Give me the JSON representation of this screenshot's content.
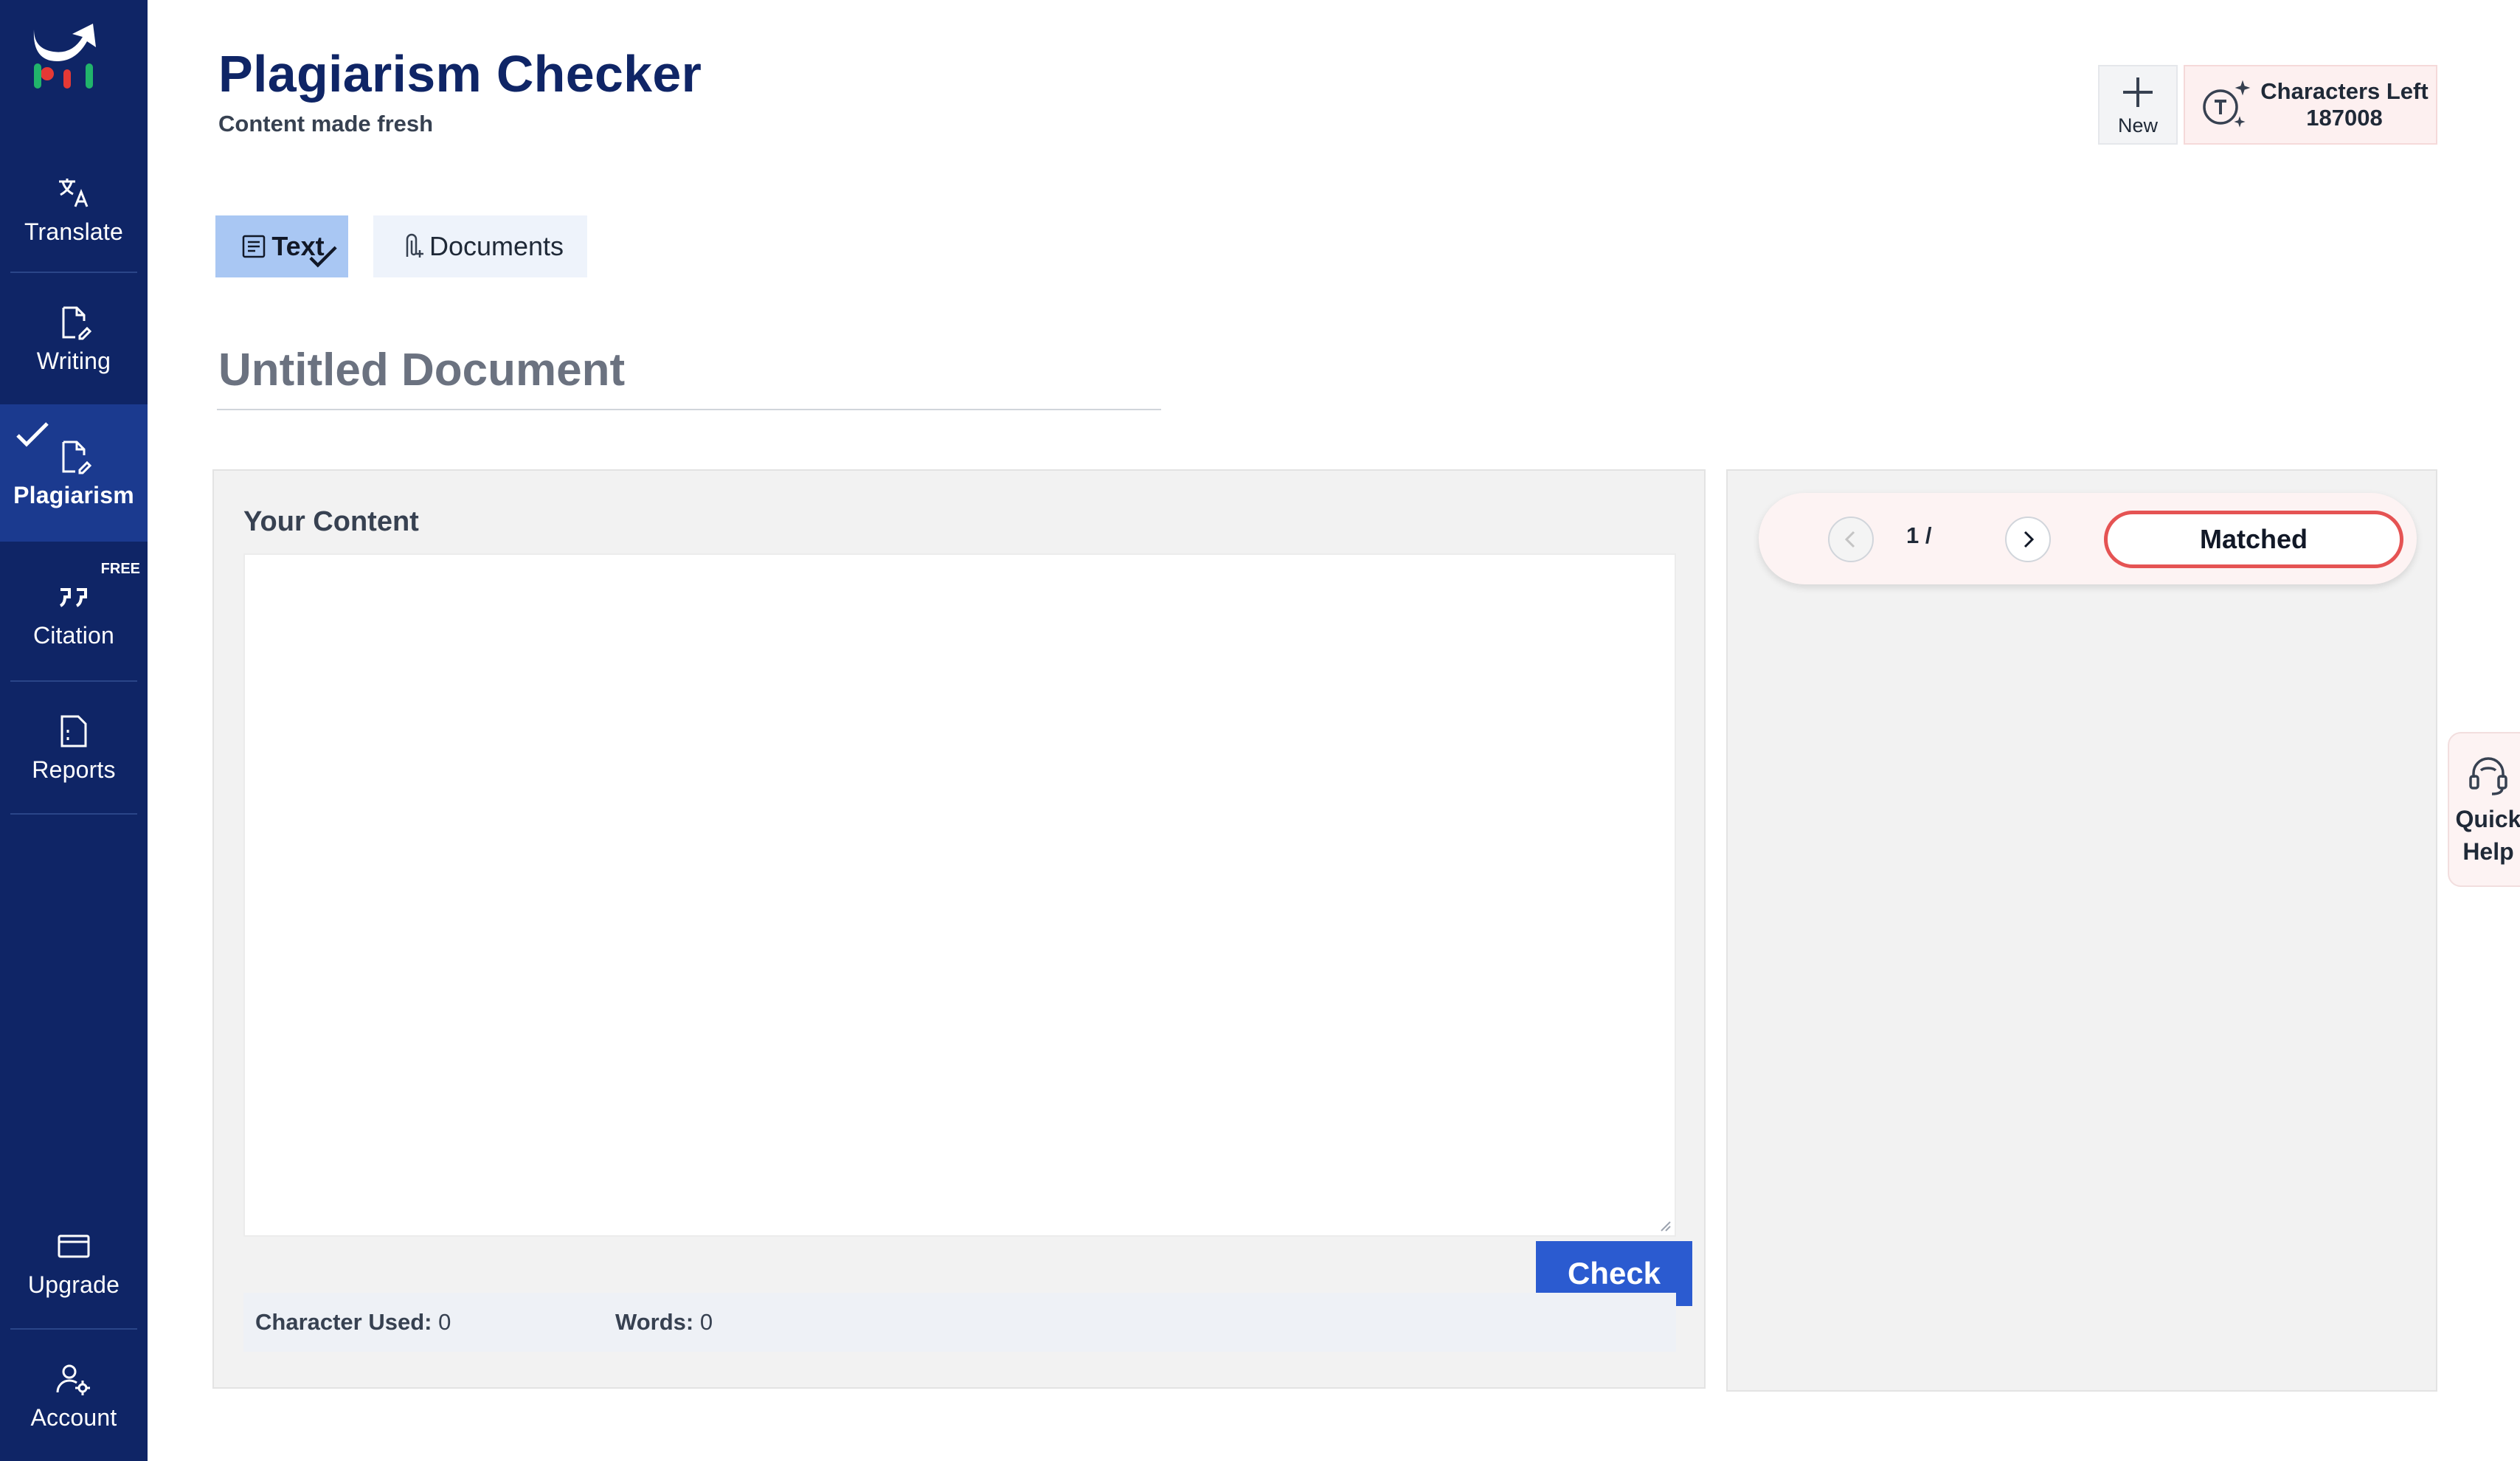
{
  "app": {
    "title": "Plagiarism Checker",
    "subtitle": "Content made fresh"
  },
  "sidebar": {
    "items": [
      {
        "label": "Translate",
        "icon": "translate-icon"
      },
      {
        "label": "Writing",
        "icon": "writing-icon"
      },
      {
        "label": "Plagiarism",
        "icon": "plagiarism-icon",
        "active": true
      },
      {
        "label": "Citation",
        "icon": "quote-icon",
        "badge": "FREE"
      },
      {
        "label": "Reports",
        "icon": "reports-icon"
      },
      {
        "label": "Upgrade",
        "icon": "card-icon"
      },
      {
        "label": "Account",
        "icon": "account-icon"
      }
    ]
  },
  "header": {
    "new_label": "New",
    "chars_left_label": "Characters Left",
    "chars_left_value": "187008"
  },
  "tabs": [
    {
      "label": "Text",
      "active": true
    },
    {
      "label": "Documents",
      "active": false
    }
  ],
  "document": {
    "title": "Untitled Document"
  },
  "content": {
    "label": "Your Content",
    "value": "",
    "check_label": "Check",
    "char_used_label": "Character Used:",
    "char_used_value": "0",
    "words_label": "Words:",
    "words_value": "0"
  },
  "results": {
    "page": "1 /",
    "matched_label": "Matched"
  },
  "quick_help": {
    "line1": "Quick",
    "line2": "Help"
  },
  "colors": {
    "sidebar_bg": "#0f2566",
    "sidebar_active": "#1b3a8f",
    "primary_button": "#2b5bd0",
    "matched_border": "#e55353",
    "tab_active": "#a9c7f3"
  }
}
